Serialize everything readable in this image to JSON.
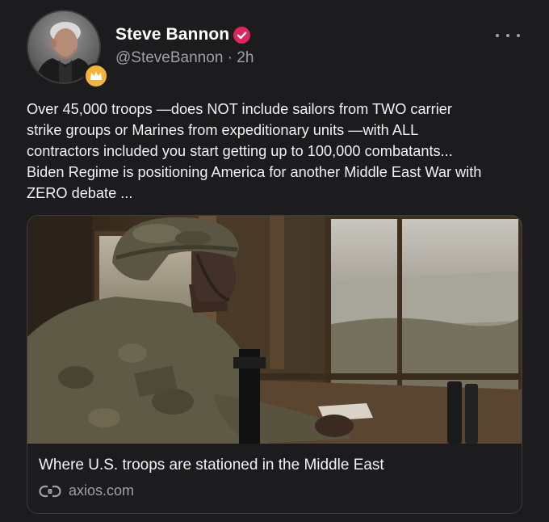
{
  "author": {
    "display_name": "Steve Bannon",
    "handle": "@SteveBannon",
    "separator": " · ",
    "time_ago": "2h",
    "verified": true,
    "badge_icon": "crown-icon"
  },
  "post": {
    "text": "Over 45,000 troops —does NOT include sailors from TWO carrier\nstrike groups or Marines from expeditionary units —with ALL\ncontractors included you start getting up to 100,000 combatants...\nBiden Regime is positioning America for another Middle East War with\nZERO debate ..."
  },
  "link_card": {
    "title": "Where U.S. troops are stationed in the Middle East",
    "domain": "axios.com",
    "image_subject": "soldier in combat helmet and camouflage uniform looking out a window"
  },
  "icons": {
    "more": "more-options-icon",
    "link": "link-icon",
    "verified": "verified-check-icon"
  },
  "colors": {
    "background": "#1c1c1e",
    "verified_red": "#e0245e",
    "badge_gold": "#f4b43a",
    "secondary_text": "#a0a0a5"
  }
}
